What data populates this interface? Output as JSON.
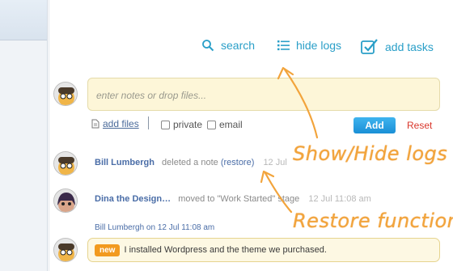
{
  "toolbar": {
    "search_label": "search",
    "hide_logs_label": "hide logs",
    "add_tasks_label": "add tasks"
  },
  "composer": {
    "placeholder": "enter notes or drop files...",
    "add_files_label": "add files",
    "private_label": "private",
    "email_label": "email",
    "add_button": "Add",
    "reset_link": "Reset"
  },
  "feed": {
    "entry1": {
      "user": "Bill Lumbergh",
      "action": "deleted a note",
      "restore": "(restore)",
      "time": "12 Jul"
    },
    "entry2": {
      "user": "Dina the Design…",
      "action": "moved to \"Work Started\" stage",
      "time": "12 Jul 11:08 am"
    },
    "comment": {
      "meta": "Bill Lumbergh on 12 Jul 11:08 am",
      "badge": "new",
      "text": "I installed Wordpress and the theme we purchased."
    }
  },
  "annotations": {
    "show_hide": "Show/Hide logs",
    "restore_fn": "Restore function"
  },
  "colors": {
    "accent": "#2a9fc8",
    "annotation": "#f2a43c",
    "link": "#4a6da7",
    "badge": "#f29a1f",
    "reset": "#d9362b"
  }
}
